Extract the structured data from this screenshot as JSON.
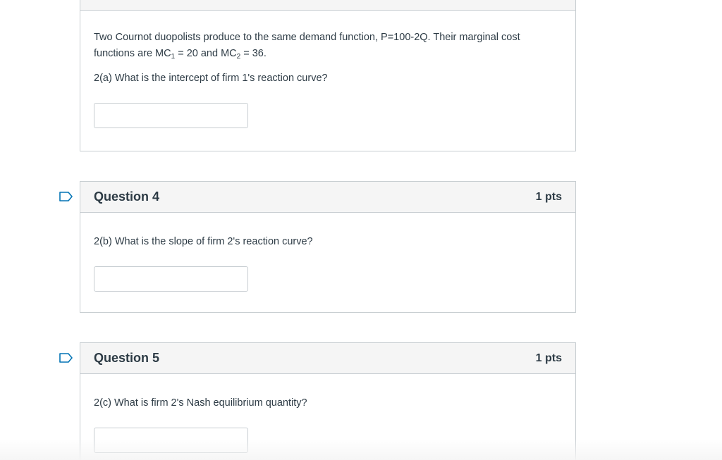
{
  "question3": {
    "intro_line1": "Two Cournot duopolists produce to the same demand function, P=100-2Q. Their marginal cost",
    "intro_line2_a": "functions are MC",
    "sub1": "1",
    "intro_line2_b": " = 20 and  MC",
    "sub2": "2",
    "intro_line2_c": " = 36.",
    "prompt": "2(a)  What is the intercept of firm 1's reaction curve?",
    "answer_value": ""
  },
  "question4": {
    "title": "Question 4",
    "points": "1 pts",
    "prompt": "2(b)  What is the slope of firm 2's reaction curve?",
    "answer_value": ""
  },
  "question5": {
    "title": "Question 5",
    "points": "1 pts",
    "prompt": "2(c)  What is firm 2's Nash equilibrium quantity?",
    "answer_value": ""
  },
  "icons": {
    "flag": "flag-question-icon"
  },
  "colors": {
    "border": "#c7cdd1",
    "header_bg": "#f5f5f5",
    "text": "#2d3b45",
    "flag": "#0374b5"
  }
}
